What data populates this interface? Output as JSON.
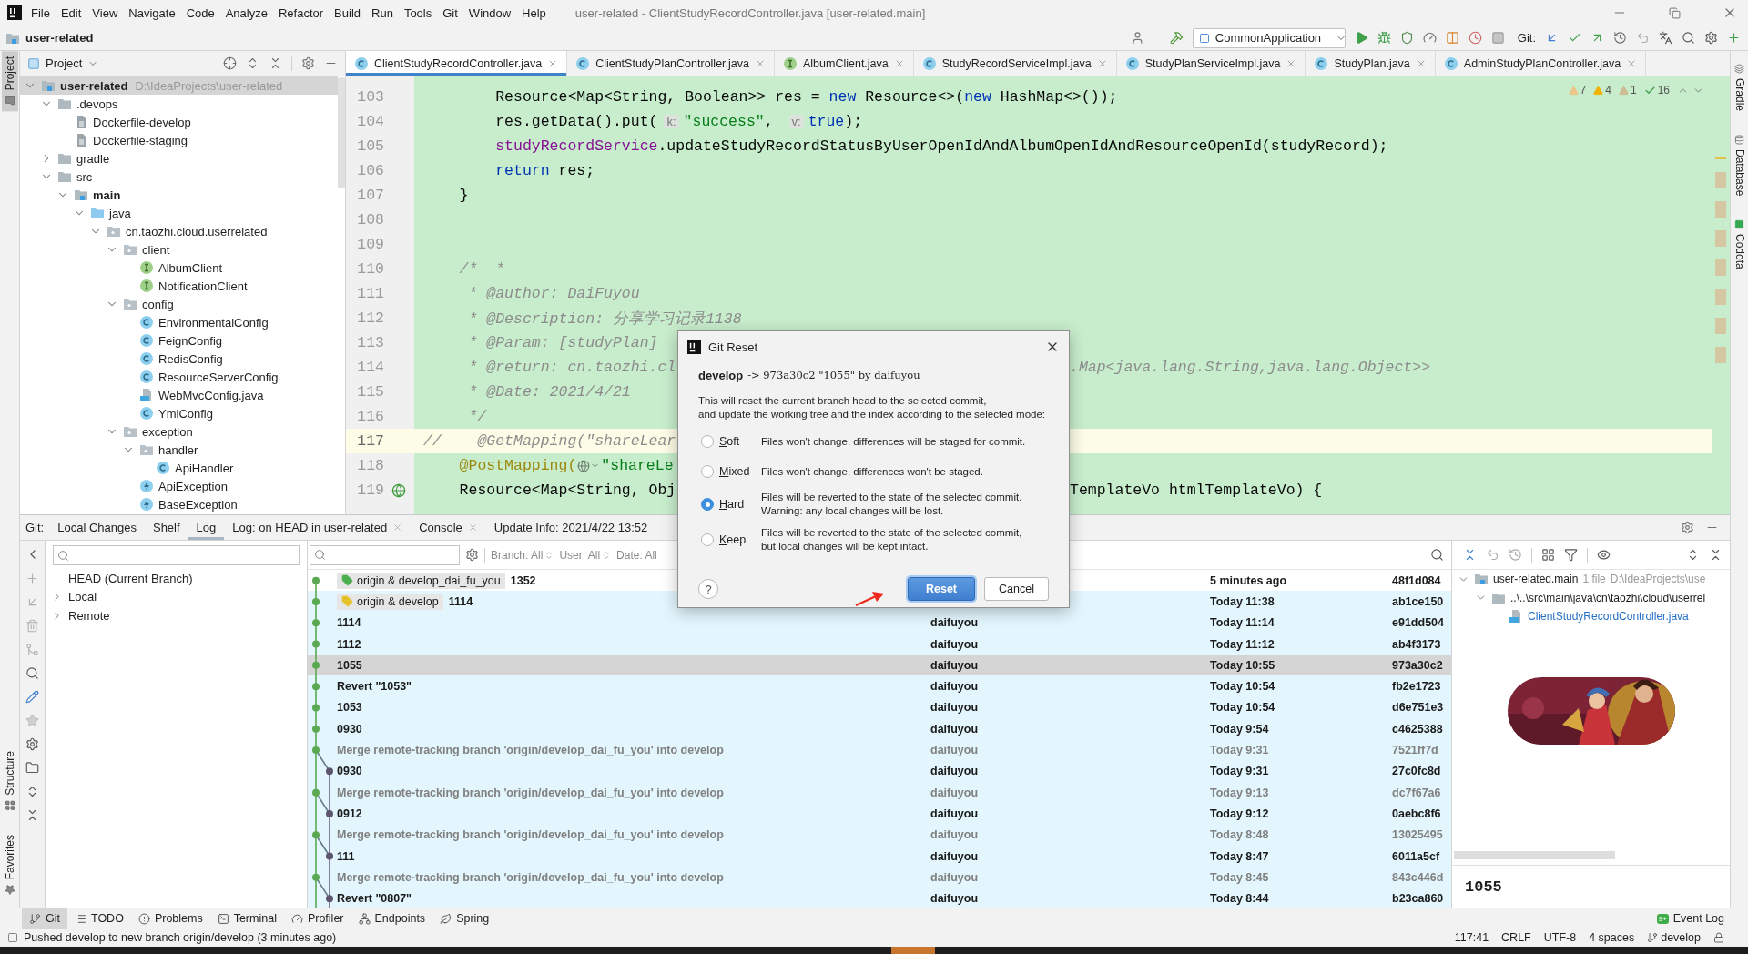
{
  "window": {
    "title": "user-related - ClientStudyRecordController.java [user-related.main]"
  },
  "menu": [
    "File",
    "Edit",
    "View",
    "Navigate",
    "Code",
    "Analyze",
    "Refactor",
    "Build",
    "Run",
    "Tools",
    "Git",
    "Window",
    "Help"
  ],
  "navbar": {
    "project": "user-related",
    "run_config": "CommonApplication",
    "vcs_label": "Git:"
  },
  "left_stripe": {
    "top": [
      {
        "label": "Project",
        "selected": true
      }
    ],
    "bottom": [
      {
        "label": "Structure",
        "selected": false
      },
      {
        "label": "Favorites",
        "selected": false
      }
    ]
  },
  "right_stripe": [
    {
      "label": "Gradle"
    },
    {
      "label": "Database"
    },
    {
      "label": "Codota"
    }
  ],
  "project_panel": {
    "title": "Project",
    "tree": [
      {
        "label": "user-related",
        "kind": "module",
        "path": "D:\\IdeaProjects\\user-related",
        "expanded": true,
        "selected": true,
        "children": [
          {
            "label": ".devops",
            "kind": "folder",
            "expanded": true,
            "selected": false,
            "children": [
              {
                "label": "Dockerfile-develop",
                "kind": "file",
                "selected": false
              },
              {
                "label": "Dockerfile-staging",
                "kind": "file",
                "selected": false
              }
            ]
          },
          {
            "label": "gradle",
            "kind": "folder",
            "expanded": false,
            "selected": false
          },
          {
            "label": "src",
            "kind": "folder",
            "expanded": true,
            "selected": false,
            "children": [
              {
                "label": "main",
                "kind": "source-set",
                "expanded": true,
                "selected": false,
                "children": [
                  {
                    "label": "java",
                    "kind": "source-root",
                    "expanded": true,
                    "selected": false,
                    "children": [
                      {
                        "label": "cn.taozhi.cloud.userrelated",
                        "kind": "package",
                        "expanded": true,
                        "selected": false,
                        "children": [
                          {
                            "label": "client",
                            "kind": "package",
                            "expanded": true,
                            "selected": false,
                            "children": [
                              {
                                "label": "AlbumClient",
                                "kind": "interface",
                                "selected": false
                              },
                              {
                                "label": "NotificationClient",
                                "kind": "interface",
                                "selected": false
                              }
                            ]
                          },
                          {
                            "label": "config",
                            "kind": "package",
                            "expanded": true,
                            "selected": false,
                            "children": [
                              {
                                "label": "EnvironmentalConfig",
                                "kind": "class",
                                "selected": false
                              },
                              {
                                "label": "FeignConfig",
                                "kind": "class",
                                "selected": false
                              },
                              {
                                "label": "RedisConfig",
                                "kind": "class",
                                "selected": false
                              },
                              {
                                "label": "ResourceServerConfig",
                                "kind": "class",
                                "selected": false
                              },
                              {
                                "label": "WebMvcConfig.java",
                                "kind": "java-file",
                                "selected": false
                              },
                              {
                                "label": "YmlConfig",
                                "kind": "class",
                                "selected": false
                              }
                            ]
                          },
                          {
                            "label": "exception",
                            "kind": "package",
                            "expanded": true,
                            "selected": false,
                            "children": [
                              {
                                "label": "handler",
                                "kind": "package",
                                "expanded": true,
                                "selected": false,
                                "children": [
                                  {
                                    "label": "ApiHandler",
                                    "kind": "class",
                                    "selected": false
                                  }
                                ]
                              },
                              {
                                "label": "ApiException",
                                "kind": "exception",
                                "selected": false
                              },
                              {
                                "label": "BaseException",
                                "kind": "exception",
                                "selected": false
                              }
                            ]
                          }
                        ]
                      }
                    ]
                  }
                ]
              }
            ]
          }
        ]
      }
    ]
  },
  "editor": {
    "tabs": [
      {
        "label": "ClientStudyRecordController.java",
        "kind": "class",
        "selected": true
      },
      {
        "label": "ClientStudyPlanController.java",
        "kind": "class",
        "selected": false
      },
      {
        "label": "AlbumClient.java",
        "kind": "interface",
        "selected": false
      },
      {
        "label": "StudyRecordServiceImpl.java",
        "kind": "class",
        "selected": false
      },
      {
        "label": "StudyPlanServiceImpl.java",
        "kind": "class",
        "selected": false
      },
      {
        "label": "StudyPlan.java",
        "kind": "class",
        "selected": false
      },
      {
        "label": "AdminStudyPlanController.java",
        "kind": "class",
        "selected": false
      }
    ],
    "inspections": [
      {
        "kind": "weak",
        "count": "7"
      },
      {
        "kind": "warning",
        "count": "4"
      },
      {
        "kind": "info",
        "count": "1"
      },
      {
        "kind": "typo",
        "count": "16"
      }
    ],
    "lines": [
      {
        "number": "103",
        "current": false,
        "parts": [
          {
            "kind": "code",
            "tokens": [
              {
                "kind": "plain",
                "text": "        Resource<Map<String, Boolean>> res = "
              },
              {
                "kind": "keyword",
                "text": "new"
              },
              {
                "kind": "plain",
                "text": " Resource<>("
              },
              {
                "kind": "keyword",
                "text": "new"
              },
              {
                "kind": "plain",
                "text": " HashMap<>());"
              }
            ]
          }
        ]
      },
      {
        "number": "104",
        "current": false,
        "parts": [
          {
            "kind": "code",
            "tokens": [
              {
                "kind": "plain",
                "text": "        res.getData().put("
              },
              {
                "kind": "hint",
                "text": "k:"
              },
              {
                "kind": "string",
                "text": "\"success\""
              },
              {
                "kind": "plain",
                "text": ", "
              },
              {
                "kind": "hint",
                "text": "v:"
              },
              {
                "kind": "keyword",
                "text": "true"
              },
              {
                "kind": "plain",
                "text": ");"
              }
            ]
          }
        ]
      },
      {
        "number": "105",
        "current": false,
        "parts": [
          {
            "kind": "code",
            "tokens": [
              {
                "kind": "field",
                "text": "        studyRecordService"
              },
              {
                "kind": "plain",
                "text": ".updateStudyRecordStatusByUserOpenIdAndAlbumOpenIdAndResourceOpenId(studyRecord);"
              }
            ]
          }
        ]
      },
      {
        "number": "106",
        "current": false,
        "parts": [
          {
            "kind": "code",
            "tokens": [
              {
                "kind": "keyword",
                "text": "        return"
              },
              {
                "kind": "plain",
                "text": " res;"
              }
            ]
          }
        ]
      },
      {
        "number": "107",
        "current": false,
        "parts": [
          {
            "kind": "code",
            "tokens": [
              {
                "kind": "plain",
                "text": "    }"
              }
            ]
          }
        ]
      },
      {
        "number": "108",
        "current": false
      },
      {
        "number": "109",
        "current": false
      },
      {
        "number": "110",
        "current": false,
        "parts": [
          {
            "kind": "code",
            "tokens": [
              {
                "kind": "doc",
                "text": "    /*  *"
              }
            ]
          }
        ]
      },
      {
        "number": "111",
        "current": false,
        "parts": [
          {
            "kind": "code",
            "tokens": [
              {
                "kind": "doc",
                "text": "     * @author: DaiFuyou"
              }
            ]
          }
        ]
      },
      {
        "number": "112",
        "current": false,
        "parts": [
          {
            "kind": "code",
            "tokens": [
              {
                "kind": "doc",
                "text": "     * @Description: 分享学习记录1138"
              }
            ]
          }
        ]
      },
      {
        "number": "113",
        "current": false,
        "parts": [
          {
            "kind": "code",
            "tokens": [
              {
                "kind": "doc",
                "text": "     * @Param: [studyPlan]"
              }
            ]
          }
        ]
      },
      {
        "number": "114",
        "current": false,
        "parts": [
          {
            "kind": "code",
            "tokens": [
              {
                "kind": "doc",
                "text": "     * @return: cn.taozhi.cl"
              }
            ]
          }
        ],
        "tail": [
          {
            "kind": "doc",
            "text": ".Map<java.lang.String,java.lang.Object>>"
          }
        ]
      },
      {
        "number": "115",
        "current": false,
        "parts": [
          {
            "kind": "code",
            "tokens": [
              {
                "kind": "doc",
                "text": "     * @Date: 2021/4/21"
              }
            ]
          }
        ]
      },
      {
        "number": "116",
        "current": false,
        "parts": [
          {
            "kind": "code",
            "tokens": [
              {
                "kind": "doc",
                "text": "     */"
              }
            ]
          }
        ]
      },
      {
        "number": "117",
        "current": true,
        "parts": [
          {
            "kind": "code",
            "tokens": [
              {
                "kind": "comment",
                "text": "//    @GetMapping(\"shareLear"
              }
            ]
          }
        ]
      },
      {
        "number": "118",
        "current": false,
        "parts": [
          {
            "kind": "code",
            "tokens": [
              {
                "kind": "annotation",
                "text": "    @PostMapping("
              }
            ]
          },
          {
            "kind": "inlay"
          },
          {
            "kind": "code",
            "tokens": [
              {
                "kind": "string",
                "text": "\"shareLe"
              }
            ]
          }
        ]
      },
      {
        "number": "119",
        "current": false,
        "gutter_icon": true,
        "parts": [
          {
            "kind": "code",
            "tokens": [
              {
                "kind": "plain",
                "text": "    Resource<Map<String, Obj"
              }
            ]
          }
        ],
        "tail": [
          {
            "kind": "plain",
            "text": "TemplateVo htmlTemplateVo) {"
          }
        ]
      }
    ]
  },
  "git_panel": {
    "label": "Git:",
    "tabs": [
      {
        "label": "Local Changes",
        "selected": false,
        "closable": false
      },
      {
        "label": "Shelf",
        "selected": false,
        "closable": false
      },
      {
        "label": "Log",
        "selected": true,
        "closable": false
      },
      {
        "label": "Log: on HEAD in user-related",
        "selected": false,
        "closable": true
      },
      {
        "label": "Console",
        "selected": false,
        "closable": true
      },
      {
        "label": "Update Info: 2021/4/22 13:52",
        "selected": false,
        "closable": false
      }
    ],
    "branches": [
      {
        "label": "HEAD (Current Branch)",
        "expandable": false
      },
      {
        "label": "Local",
        "expandable": true
      },
      {
        "label": "Remote",
        "expandable": true
      }
    ],
    "log": {
      "filters": [
        {
          "label": "Branch:",
          "value": "All"
        },
        {
          "label": "User:",
          "value": "All"
        },
        {
          "label": "Date:",
          "value": "All"
        }
      ],
      "commits": [
        {
          "refs": [
            {
              "label": "origin & develop_dai_fu_you",
              "color": "#4caf50"
            }
          ],
          "message": "1352",
          "date": "5 minutes ago",
          "hash": "48f1d084",
          "kind": "main",
          "on_branch": false,
          "selected": false,
          "dimmed": false
        },
        {
          "refs": [
            {
              "label": "origin & develop",
              "color": "#e6c229"
            }
          ],
          "message": "1114",
          "date": "Today 11:38",
          "hash": "ab1ce150",
          "kind": "main",
          "on_branch": true,
          "selected": false,
          "dimmed": false
        },
        {
          "message": "1114",
          "author": "daifuyou",
          "date": "Today 11:14",
          "hash": "e91dd504",
          "kind": "main",
          "on_branch": true,
          "selected": false,
          "dimmed": false
        },
        {
          "message": "1112",
          "author": "daifuyou",
          "date": "Today 11:12",
          "hash": "ab4f3173",
          "kind": "main",
          "on_branch": true,
          "selected": false,
          "dimmed": false
        },
        {
          "message": "1055",
          "author": "daifuyou",
          "date": "Today 10:55",
          "hash": "973a30c2",
          "kind": "main",
          "on_branch": true,
          "selected": true,
          "dimmed": false
        },
        {
          "message": "Revert \"1053\"",
          "author": "daifuyou",
          "date": "Today 10:54",
          "hash": "fb2e1723",
          "kind": "main",
          "on_branch": true,
          "selected": false,
          "dimmed": false
        },
        {
          "message": "1053",
          "author": "daifuyou",
          "date": "Today 10:54",
          "hash": "d6e751e3",
          "kind": "main",
          "on_branch": true,
          "selected": false,
          "dimmed": false
        },
        {
          "message": "0930",
          "author": "daifuyou",
          "date": "Today 9:54",
          "hash": "c4625388",
          "kind": "main",
          "on_branch": true,
          "selected": false,
          "dimmed": false
        },
        {
          "message": "Merge remote-tracking branch 'origin/develop_dai_fu_you' into develop",
          "author": "daifuyou",
          "date": "Today 9:31",
          "hash": "7521ff7d",
          "kind": "main",
          "on_branch": true,
          "selected": false,
          "dimmed": true
        },
        {
          "message": "0930",
          "author": "daifuyou",
          "date": "Today 9:31",
          "hash": "27c0fc8d",
          "kind": "side",
          "on_branch": true,
          "selected": false,
          "dimmed": false
        },
        {
          "message": "Merge remote-tracking branch 'origin/develop_dai_fu_you' into develop",
          "author": "daifuyou",
          "date": "Today 9:13",
          "hash": "dc7f67a6",
          "kind": "main",
          "on_branch": true,
          "selected": false,
          "dimmed": true
        },
        {
          "message": "0912",
          "author": "daifuyou",
          "date": "Today 9:12",
          "hash": "0aebc8f6",
          "kind": "side",
          "on_branch": true,
          "selected": false,
          "dimmed": false
        },
        {
          "message": "Merge remote-tracking branch 'origin/develop_dai_fu_you' into develop",
          "author": "daifuyou",
          "date": "Today 8:48",
          "hash": "13025495",
          "kind": "main",
          "on_branch": true,
          "selected": false,
          "dimmed": true
        },
        {
          "message": "111",
          "author": "daifuyou",
          "date": "Today 8:47",
          "hash": "6011a5cf",
          "kind": "side",
          "on_branch": true,
          "selected": false,
          "dimmed": false
        },
        {
          "message": "Merge remote-tracking branch 'origin/develop_dai_fu_you' into develop",
          "author": "daifuyou",
          "date": "Today 8:45",
          "hash": "843c446d",
          "kind": "main",
          "on_branch": true,
          "selected": false,
          "dimmed": true
        },
        {
          "message": "Revert \"0807\"",
          "author": "daifuyou",
          "date": "Today 8:44",
          "hash": "b23ca860",
          "kind": "side",
          "on_branch": true,
          "selected": false,
          "dimmed": false
        }
      ]
    },
    "changes": [
      {
        "label": "user-related.main",
        "kind": "module",
        "count": "1 file",
        "path": "D:\\IdeaProjects\\use",
        "expanded": true,
        "children": [
          {
            "label": "..\\..\\src\\main\\java\\cn\\taozhi\\cloud\\userrel",
            "kind": "folder",
            "expanded": true,
            "children": [
              {
                "label": "ClientStudyRecordController.java",
                "kind": "java-file"
              }
            ]
          }
        ]
      }
    ],
    "details": "1055"
  },
  "bottom_toolbar": {
    "items": [
      {
        "label": "Git",
        "selected": true
      },
      {
        "label": "TODO",
        "selected": false
      },
      {
        "label": "Problems",
        "selected": false
      },
      {
        "label": "Terminal",
        "selected": false
      },
      {
        "label": "Profiler",
        "selected": false
      },
      {
        "label": "Endpoints",
        "selected": false
      },
      {
        "label": "Spring",
        "selected": false
      }
    ],
    "event_log": {
      "label": "Event Log",
      "badge": "9+"
    }
  },
  "status_bar": {
    "message": "Pushed develop to new branch origin/develop (3 minutes ago)",
    "items": [
      "117:41",
      "CRLF",
      "UTF-8",
      "4 spaces"
    ],
    "branch": "develop"
  },
  "dialog": {
    "title": "Git Reset",
    "branch": "develop",
    "target": "-> 973a30c2 \"1055\" by daifuyou",
    "description": "This will reset the current branch head to the selected commit,\nand update the working tree and the index according to the selected mode:",
    "modes": [
      {
        "label": "Soft",
        "description": "Files won't change, differences will be staged for commit.",
        "selected": false
      },
      {
        "label": "Mixed",
        "description": "Files won't change, differences won't be staged.",
        "selected": false
      },
      {
        "label": "Hard",
        "description": "Files will be reverted to the state of the selected commit.\nWarning: any local changes will be lost.",
        "selected": true
      },
      {
        "label": "Keep",
        "description": "Files will be reverted to the state of the selected commit,\nbut local changes will be kept intact.",
        "selected": false
      }
    ],
    "help": "?",
    "buttons": [
      {
        "label": "Reset",
        "primary": true
      },
      {
        "label": "Cancel",
        "primary": false
      }
    ]
  }
}
